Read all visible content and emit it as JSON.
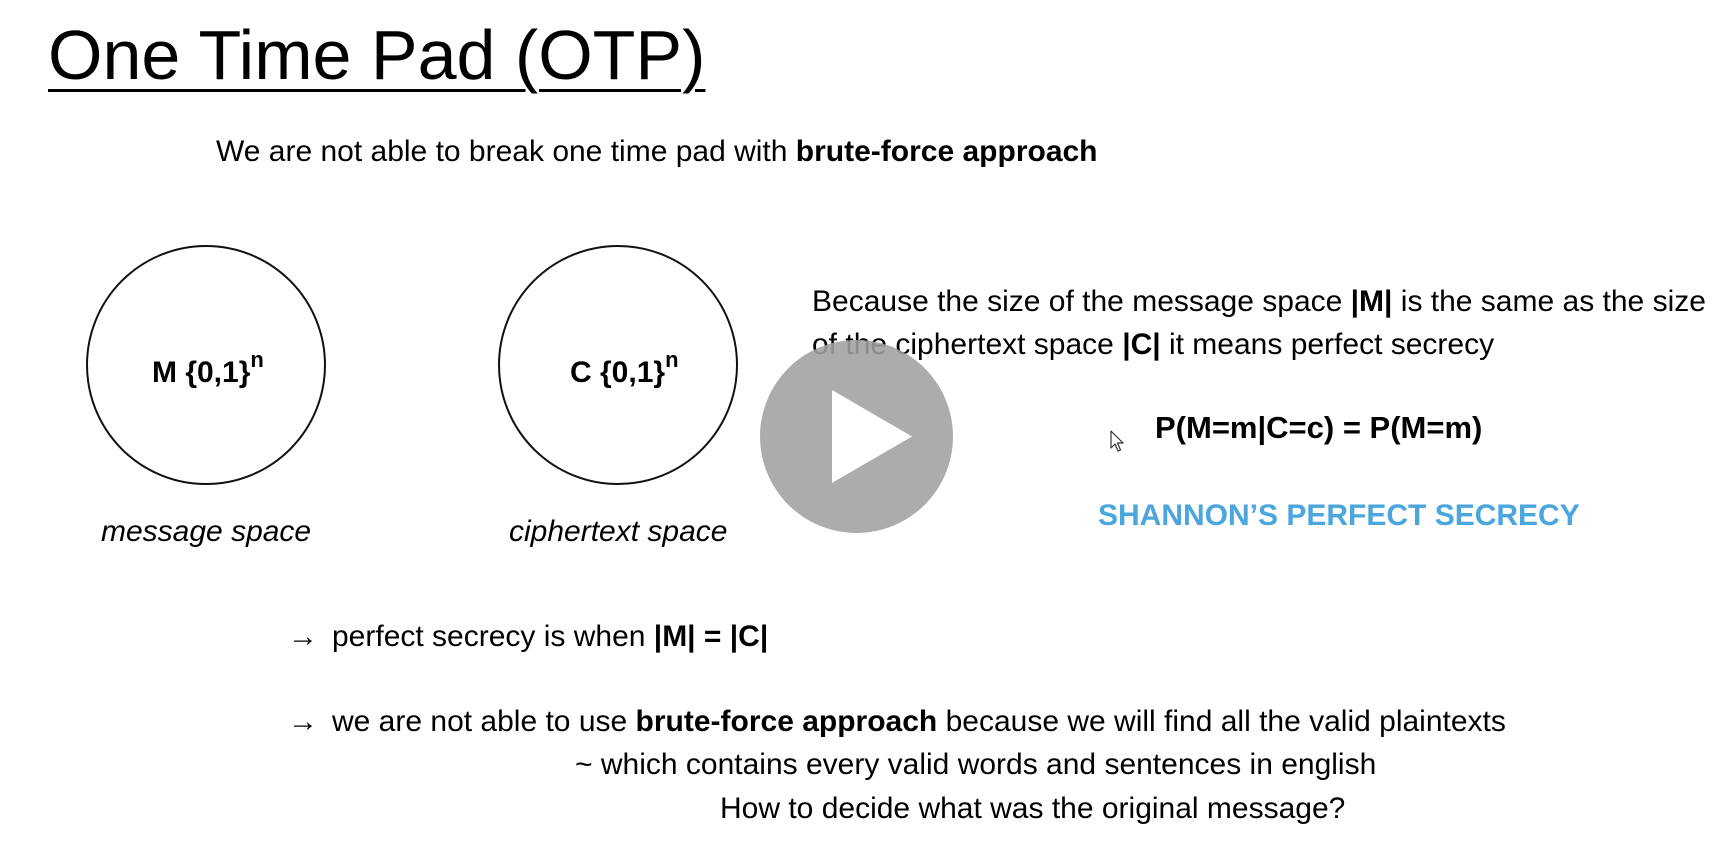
{
  "slide": {
    "title": "One Time Pad (OTP)",
    "intro": {
      "text": "We are not able to break one time pad with ",
      "bold": "brute-force approach"
    },
    "circles": [
      {
        "label": "M {0,1}",
        "sup": "n",
        "caption": "message space"
      },
      {
        "label": "C {0,1}",
        "sup": "n",
        "caption": "ciphertext space"
      }
    ],
    "explanation": {
      "part1": "Because the size of the message space ",
      "bold1": "|M|",
      "part2": " is the same as the size of the ciphertext space ",
      "bold2": "|C|",
      "part3": " it means perfect secrecy"
    },
    "formula": "P(M=m|C=c) = P(M=m)",
    "shannon": "SHANNON’S PERFECT SECRECY",
    "bullet1": {
      "arrow": "→",
      "text": "perfect secrecy is when ",
      "bold": "|M| = |C|"
    },
    "bullet2": {
      "arrow": "→",
      "text": "we are not able to use ",
      "bold": "brute-force approach",
      "rest": " because we will find all the valid plaintexts"
    },
    "line2": "~ which contains every valid words and sentences in english",
    "line3": "How to decide what was the original message?"
  },
  "player": {
    "play_icon": "play-icon",
    "cursor_icon": "mouse-pointer-icon",
    "overlay_color": "#a0a0a0"
  }
}
